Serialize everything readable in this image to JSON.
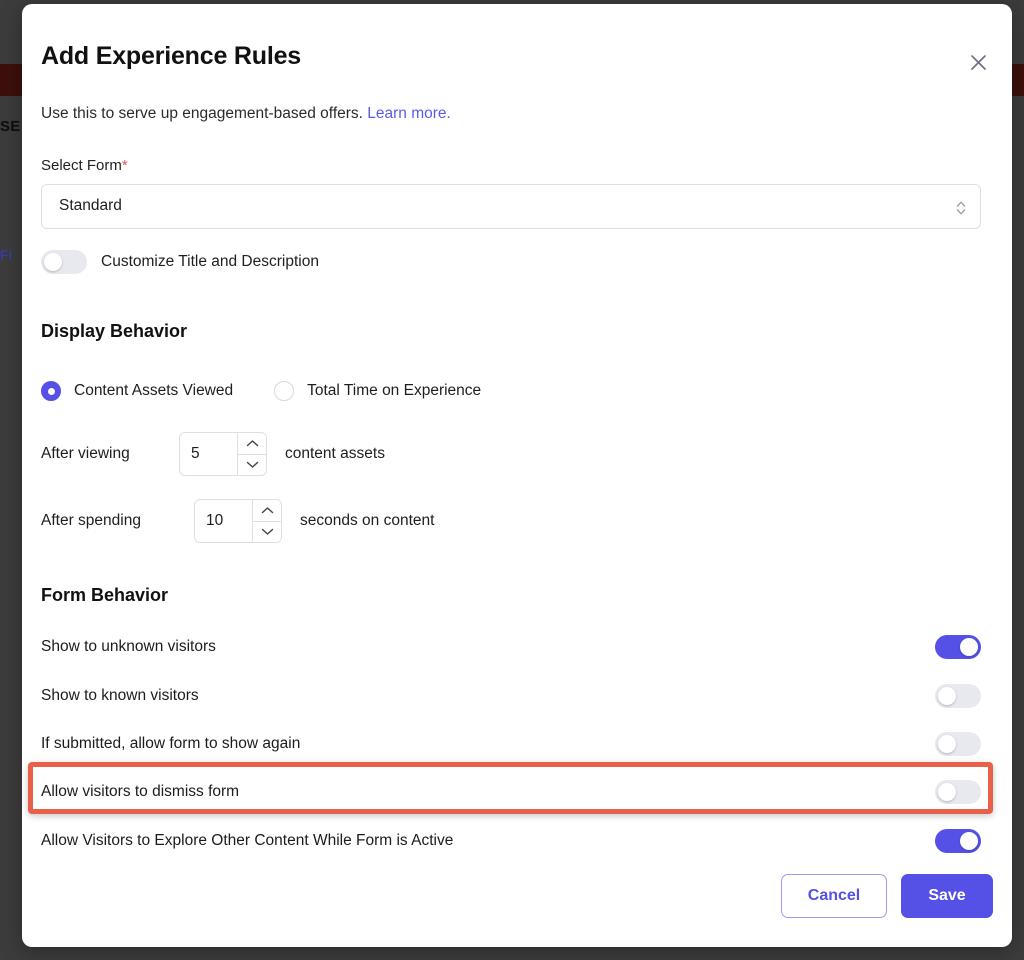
{
  "background": {
    "banner_text": "SE",
    "link_text": "FI",
    "band_color": "#3d0f0c",
    "overlay_color": "#3c3c3c"
  },
  "modal": {
    "title": "Add Experience Rules",
    "close_icon": "close-icon",
    "subtitle": {
      "text": "Use this to serve up engagement-based offers.",
      "link_text": "Learn more.",
      "link_color": "#5b5bea"
    },
    "select_form": {
      "label": "Select Form",
      "required_marker": "*",
      "value": "Standard",
      "options": [
        "Standard"
      ],
      "caret_icon": "chevron-updown-icon"
    },
    "customize_toggle": {
      "label": "Customize Title and Description",
      "on": false
    },
    "display_behavior": {
      "heading": "Display Behavior",
      "radios": [
        {
          "label": "Content Assets Viewed",
          "checked": true
        },
        {
          "label": "Total Time on Experience",
          "checked": false
        }
      ],
      "steppers": [
        {
          "prefix": "After viewing",
          "value": "5",
          "suffix": "content assets",
          "up_icon": "chevron-up-icon",
          "down_icon": "chevron-down-icon"
        },
        {
          "prefix": "After spending",
          "value": "10",
          "suffix": "seconds on content",
          "up_icon": "chevron-up-icon",
          "down_icon": "chevron-down-icon"
        }
      ]
    },
    "form_behavior": {
      "heading": "Form Behavior",
      "rows": [
        {
          "label": "Show to unknown visitors",
          "on": true,
          "highlighted": false
        },
        {
          "label": "Show to known visitors",
          "on": false,
          "highlighted": false
        },
        {
          "label": "If submitted, allow form to show again",
          "on": false,
          "highlighted": false
        },
        {
          "label": "Allow visitors to dismiss form",
          "on": false,
          "highlighted": true
        },
        {
          "label": "Allow Visitors to Explore Other Content While Form is Active",
          "on": true,
          "highlighted": false
        }
      ]
    },
    "footer": {
      "cancel_label": "Cancel",
      "save_label": "Save"
    },
    "colors": {
      "accent": "#5550e6",
      "highlight": "#e8604a",
      "required": "#e2574c"
    }
  }
}
